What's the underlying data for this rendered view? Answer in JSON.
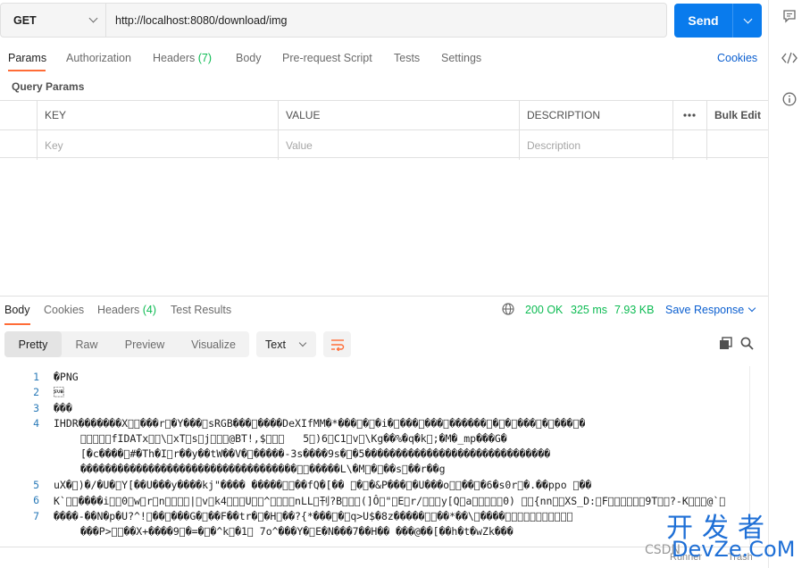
{
  "request": {
    "method": "GET",
    "url": "http://localhost:8080/download/img",
    "send_label": "Send"
  },
  "request_tabs": [
    {
      "label": "Params",
      "count": ""
    },
    {
      "label": "Authorization",
      "count": ""
    },
    {
      "label": "Headers",
      "count": "(7)"
    },
    {
      "label": "Body",
      "count": ""
    },
    {
      "label": "Pre-request Script",
      "count": ""
    },
    {
      "label": "Tests",
      "count": ""
    },
    {
      "label": "Settings",
      "count": ""
    }
  ],
  "cookies_label": "Cookies",
  "query_params": {
    "title": "Query Params",
    "headers": [
      "KEY",
      "VALUE",
      "DESCRIPTION"
    ],
    "more_icon": "ellipsis-icon",
    "bulk_edit": "Bulk Edit",
    "placeholders": [
      "Key",
      "Value",
      "Description"
    ]
  },
  "response_tabs": [
    {
      "label": "Body",
      "count": ""
    },
    {
      "label": "Cookies",
      "count": ""
    },
    {
      "label": "Headers",
      "count": "(4)"
    },
    {
      "label": "Test Results",
      "count": ""
    }
  ],
  "response_status": {
    "globe_icon": "globe-icon",
    "status": "200 OK",
    "time": "325 ms",
    "size": "7.93 KB",
    "save_response": "Save Response"
  },
  "view_modes": [
    "Pretty",
    "Raw",
    "Preview",
    "Visualize"
  ],
  "format": "Text",
  "icons": {
    "wrap": "wrap-lines-icon",
    "copy": "copy-icon",
    "search": "search-icon",
    "comment": "comment-icon",
    "code": "code-icon",
    "info": "info-icon"
  },
  "code_lines": [
    {
      "n": "1",
      "text": "�PNG"
    },
    {
      "n": "2",
      "text": "\u001a"
    },
    {
      "n": "3",
      "text": "���"
    },
    {
      "n": "4",
      "text": "IHDR�������X\u0000\u0000���r\u0000�Y���\u0000sRGB���\u0000����DeXIfMM�*���\u0000�\u0000�i�\u0000���\u0000���\u0000������\u0000�\u0000�\u0000���\u0000�\u0000���\u0000�"
    },
    {
      "n": "",
      "text": "\u0000\u0000\u0000\u0000\u0000fIDATx\u0000\u0000\\\u0000xT\u0000s\u0000j\u0000\u0000\u0000@BT!,$\u0000\u0000\u0000   5\u0000)6\u0000C1\u0000v\u0000\\Kg��%�q�k\u0000;�M�_mp���G�"
    },
    {
      "n": "",
      "text": "[�c����\u0000#�Th�I\u0000r��y��tW��V�\u0000�����-3s����9s�\u0000�5������������������������������"
    },
    {
      "n": "",
      "text": "�����������������������������������\u0000\u0000�����L\\�M\u0000�\u0000��s\u0000��r��g"
    },
    {
      "n": "5",
      "text": "uX�\u0000)�/�U�\u0000Y[��U���y����kj\"���� �����\u0000\u0000��fQ�[�� \u0000�\u0000�&P���\u0000�U���o\u0000\u0000��\u0000�6�s0r\u0000�.��ppo \u0000��"
    },
    {
      "n": "6",
      "text": "K`\u0000\u0000����i\u0000\u00000\u0000w\u0000r\u0000n\u0000\u0000\u0000\u0000|\u0000v\u0000k4\u0000\u0000\u0000U\u0000\u0000^\u0000\u0000\u0000\u0000nLL\u0000刊?B\u0000\u0000\u0000(]Ô\u0000\"\u0000E\u0000r/\u0000\u0000\u0000y[Q\u0000a\u0000\u0000\u0000\u0000\u00000) \u0000\u0000{nn\u0000\u0000XS_D:\u0000F\u0000\u0000\u0000\u0000\u0000\u00009T\u0000\u0000?-K\u0000\u0000\u0000@`\u0000"
    },
    {
      "n": "7",
      "text": "����-��N�p�U?^!\u0000��\u0000���G�\u0000��F��tr�\u0000�H\u0000��?{*���\u0000�\u0000q>U$�8z�����\u0000\u0000��*��\\\u0000����\u0000\u0000\u0000\u0000\u0000\u0000\u0000\u0000\u0000\u0000\u0000"
    },
    {
      "n": "",
      "text": "���P>\u0000\u0000��X+����9\u0000�=�\u0000�^k\u0000�1\u0000 7o^���Y�\u0000E�N���7��H�� ���@��[��h�t�wZk���"
    }
  ],
  "footer": {
    "runner": "Runner",
    "trash": "Trash"
  },
  "watermark": {
    "top": "开发者",
    "bottom": "DevZe.CoM",
    "csdn": "CSDN"
  }
}
